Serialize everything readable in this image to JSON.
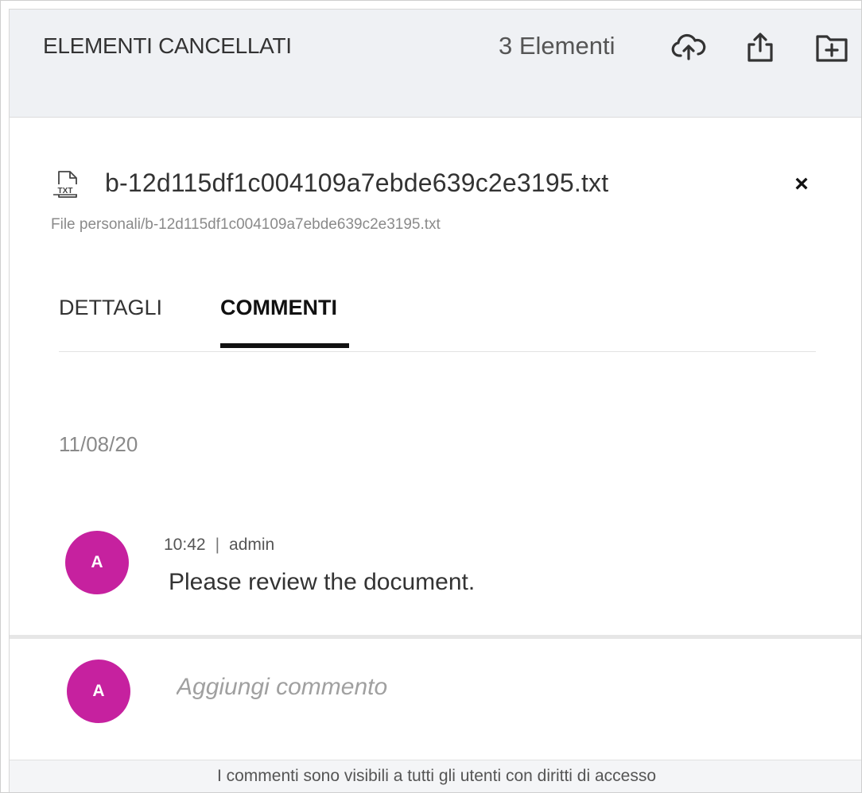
{
  "header": {
    "title": "ELEMENTI CANCELLATI",
    "item_count": "3 Elementi",
    "icons": [
      "cloud-upload-icon",
      "share-icon",
      "new-folder-icon"
    ]
  },
  "file": {
    "icon": "txt-file-icon",
    "name": "b-12d115df1c004109a7ebde639c2e3195.txt",
    "path": "File personali/b-12d115df1c004109a7ebde639c2e3195.txt",
    "close_label": "×"
  },
  "tabs": [
    {
      "label": "DETTAGLI",
      "active": false
    },
    {
      "label": "COMMENTI",
      "active": true
    }
  ],
  "comments": {
    "date": "11/08/20",
    "items": [
      {
        "avatar_initial": "A",
        "time": "10:42",
        "separator": "|",
        "author": "admin",
        "text": "Please review the document."
      }
    ],
    "input": {
      "avatar_initial": "A",
      "placeholder": "Aggiungi commento"
    },
    "footer_note": "I commenti sono visibili a tutti gli utenti con diritti di accesso"
  },
  "colors": {
    "avatar": "#c6219f",
    "header_bg": "#eff1f4",
    "tab_active": "#111111"
  }
}
